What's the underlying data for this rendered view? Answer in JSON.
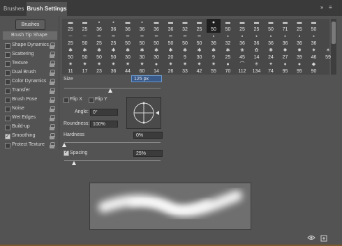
{
  "tabs": [
    {
      "label": "Brushes"
    },
    {
      "label": "Brush Settings"
    }
  ],
  "tab_controls": {
    "collapse": "»",
    "menu": "≡"
  },
  "sidebar": {
    "brushes_button": "Brushes",
    "items": [
      {
        "label": "Brush Tip Shape",
        "checked": null
      },
      {
        "label": "Shape Dynamics",
        "checked": false
      },
      {
        "label": "Scattering",
        "checked": false
      },
      {
        "label": "Texture",
        "checked": false
      },
      {
        "label": "Dual Brush",
        "checked": false
      },
      {
        "label": "Color Dynamics",
        "checked": false
      },
      {
        "label": "Transfer",
        "checked": false
      },
      {
        "label": "Brush Pose",
        "checked": false
      },
      {
        "label": "Noise",
        "checked": false
      },
      {
        "label": "Wet Edges",
        "checked": false
      },
      {
        "label": "Build-up",
        "checked": false
      },
      {
        "label": "Smoothing",
        "checked": true
      },
      {
        "label": "Protect Texture",
        "checked": false
      }
    ]
  },
  "brush_grid": {
    "selected_index": 10,
    "rows": [
      [
        "25",
        "25",
        "36",
        "36",
        "36",
        "36",
        "36",
        "36",
        "32",
        "25",
        "50",
        "50",
        "25",
        "25",
        "50",
        "71",
        "25",
        "50"
      ],
      [
        "25",
        "50",
        "25",
        "25",
        "50",
        "50",
        "50",
        "50",
        "50",
        "50",
        "36",
        "32",
        "36",
        "36",
        "36",
        "36",
        "36",
        "36"
      ],
      [
        "50",
        "50",
        "50",
        "50",
        "30",
        "30",
        "30",
        "20",
        "9",
        "30",
        "9",
        "25",
        "45",
        "14",
        "24",
        "27",
        "39",
        "46",
        "59"
      ],
      [
        "11",
        "17",
        "23",
        "36",
        "44",
        "60",
        "14",
        "26",
        "33",
        "42",
        "55",
        "70",
        "112",
        "134",
        "74",
        "95",
        "95",
        "90"
      ]
    ],
    "glyph_rows": [
      [
        "▬",
        "▬",
        "▪",
        "▪",
        "▬",
        "▪",
        "▬",
        "▬",
        "▬",
        "▬",
        "●",
        "▬",
        "▬",
        "▬",
        "▬",
        "▬",
        "▬",
        "▬"
      ],
      [
        "─",
        "─",
        "━",
        "━",
        "━",
        "━",
        "━",
        "━",
        "━",
        "━",
        "▪",
        "▪",
        "▪",
        "▪",
        "▪",
        "▪",
        "▪",
        "▪"
      ],
      [
        "✱",
        "✱",
        "✱",
        "✱",
        "✱",
        "✱",
        "✱",
        "✱",
        "✱",
        "✱",
        "✱",
        "✱",
        "❀",
        "✿",
        "✺",
        "✹",
        "✸",
        "✷",
        "✶"
      ],
      [
        "✷",
        "✷",
        "✷",
        "✷",
        "✷",
        "✷",
        "●",
        "✷",
        "✷",
        "✷",
        "✷",
        "●",
        "⌒",
        "✳",
        "✦",
        "♦",
        "●",
        "◆"
      ]
    ]
  },
  "size": {
    "label": "Size",
    "value": "125 px",
    "slider": 0.48
  },
  "flip": {
    "x_label": "Flip X",
    "y_label": "Flip Y",
    "x_checked": false,
    "y_checked": false
  },
  "angle": {
    "label": "Angle:",
    "value": "0°"
  },
  "roundness": {
    "label": "Roundness:",
    "value": "100%"
  },
  "hardness": {
    "label": "Hardness",
    "value": "0%",
    "slider": 0.0
  },
  "spacing": {
    "label": "Spacing",
    "value": "25%",
    "checked": true,
    "slider": 0.1
  },
  "bottom_icons": [
    "eye-visibility-icon",
    "new-brush-icon"
  ],
  "colors": {
    "panel": "#535353",
    "tabbar": "#3a3a3a",
    "selected_sidebar": "#6b6b6b",
    "highlight_field": "#3a5a8a"
  }
}
